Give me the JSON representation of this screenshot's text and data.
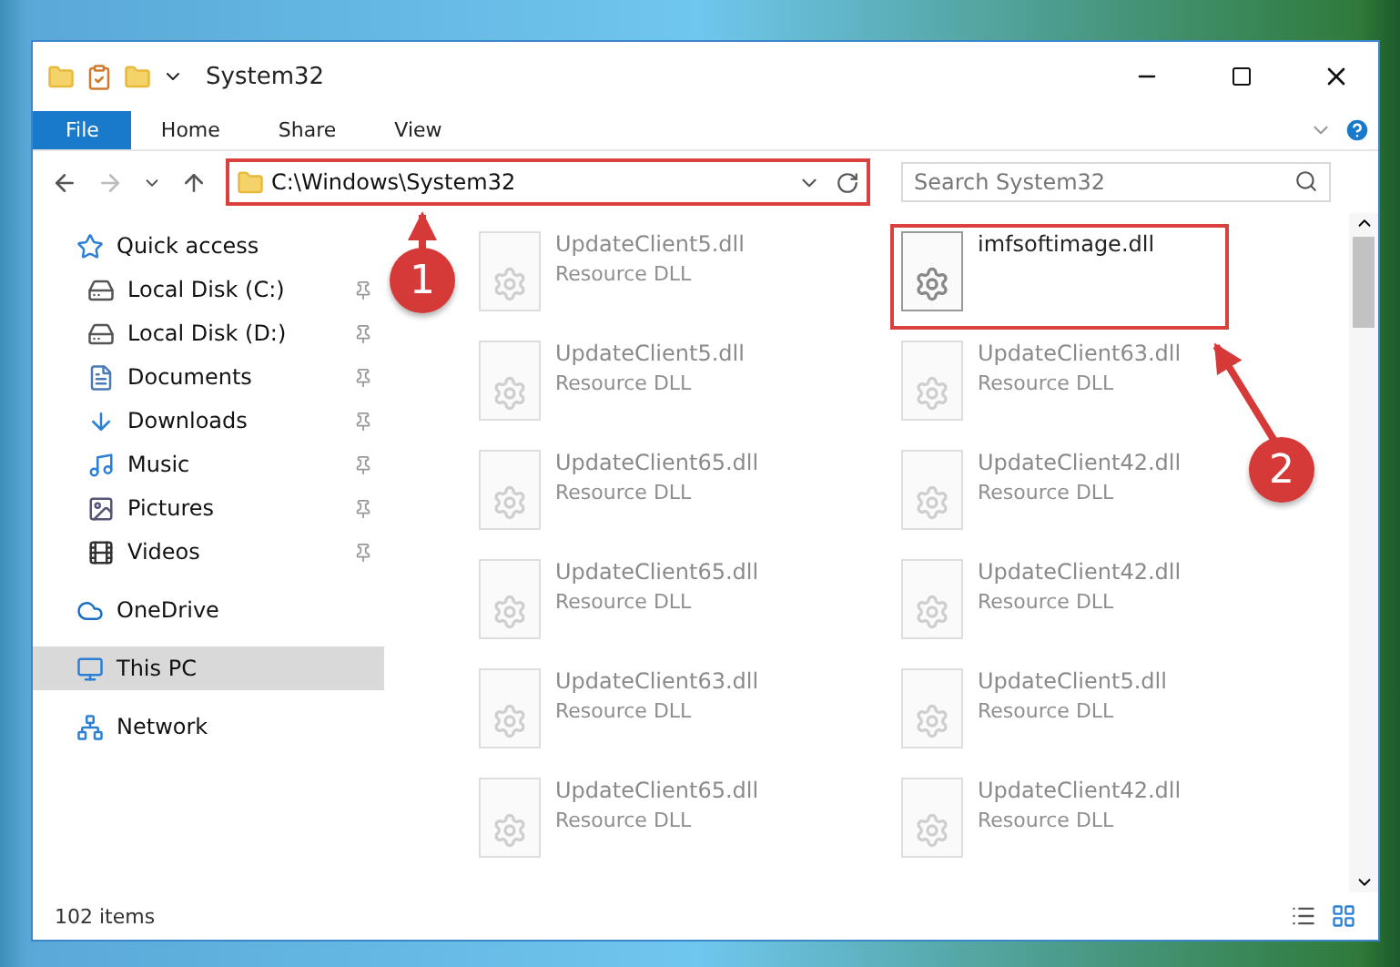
{
  "window": {
    "title": "System32"
  },
  "ribbon_tabs": [
    {
      "label": "File",
      "kind": "file"
    },
    {
      "label": "Home",
      "kind": "tab"
    },
    {
      "label": "Share",
      "kind": "tab"
    },
    {
      "label": "View",
      "kind": "tab"
    }
  ],
  "address": {
    "path": "C:\\Windows\\System32",
    "highlighted": true,
    "search_placeholder": "Search System32"
  },
  "sidebar": {
    "items": [
      {
        "label": "Quick access",
        "selected": false,
        "children": [
          {
            "label": "Local Disk (C:)",
            "pinned": true,
            "selected": false
          },
          {
            "label": "Local Disk (D:)",
            "pinned": true,
            "selected": false
          },
          {
            "label": "Documents",
            "pinned": true,
            "selected": false
          },
          {
            "label": "Downloads",
            "pinned": true,
            "selected": false
          },
          {
            "label": "Music",
            "pinned": true,
            "selected": false
          },
          {
            "label": "Pictures",
            "pinned": true,
            "selected": false
          },
          {
            "label": "Videos",
            "pinned": true,
            "selected": false
          }
        ]
      },
      {
        "label": "OneDrive",
        "selected": false
      },
      {
        "label": "This PC",
        "selected": true
      },
      {
        "label": "Network",
        "selected": false
      }
    ]
  },
  "files": [
    {
      "name": "UpdateClient5.dll",
      "type": "Resource DLL",
      "dimmed": true,
      "highlighted": false
    },
    {
      "name": "imfsoftimage.dll",
      "dimmed": false,
      "highlighted": true
    },
    {
      "name": "UpdateClient5.dll",
      "type": "Resource DLL",
      "dimmed": true,
      "highlighted": false
    },
    {
      "name": "UpdateClient63.dll",
      "type": "Resource DLL",
      "dimmed": true,
      "highlighted": false
    },
    {
      "name": "UpdateClient65.dll",
      "type": "Resource DLL",
      "dimmed": true,
      "highlighted": false
    },
    {
      "name": "UpdateClient42.dll",
      "type": "Resource DLL",
      "dimmed": true,
      "highlighted": false
    },
    {
      "name": "UpdateClient65.dll",
      "type": "Resource DLL",
      "dimmed": true,
      "highlighted": false
    },
    {
      "name": "UpdateClient42.dll",
      "type": "Resource DLL",
      "dimmed": true,
      "highlighted": false
    },
    {
      "name": "UpdateClient63.dll",
      "type": "Resource DLL",
      "dimmed": true,
      "highlighted": false
    },
    {
      "name": "UpdateClient5.dll",
      "type": "Resource DLL",
      "dimmed": true,
      "highlighted": false
    },
    {
      "name": "UpdateClient65.dll",
      "type": "Resource DLL",
      "dimmed": true,
      "highlighted": false
    },
    {
      "name": "UpdateClient42.dll",
      "type": "Resource DLL",
      "dimmed": true,
      "highlighted": false
    }
  ],
  "status_bar": {
    "count": "102 items"
  },
  "callouts": [
    {
      "number": "1"
    },
    {
      "number": "2"
    }
  ]
}
